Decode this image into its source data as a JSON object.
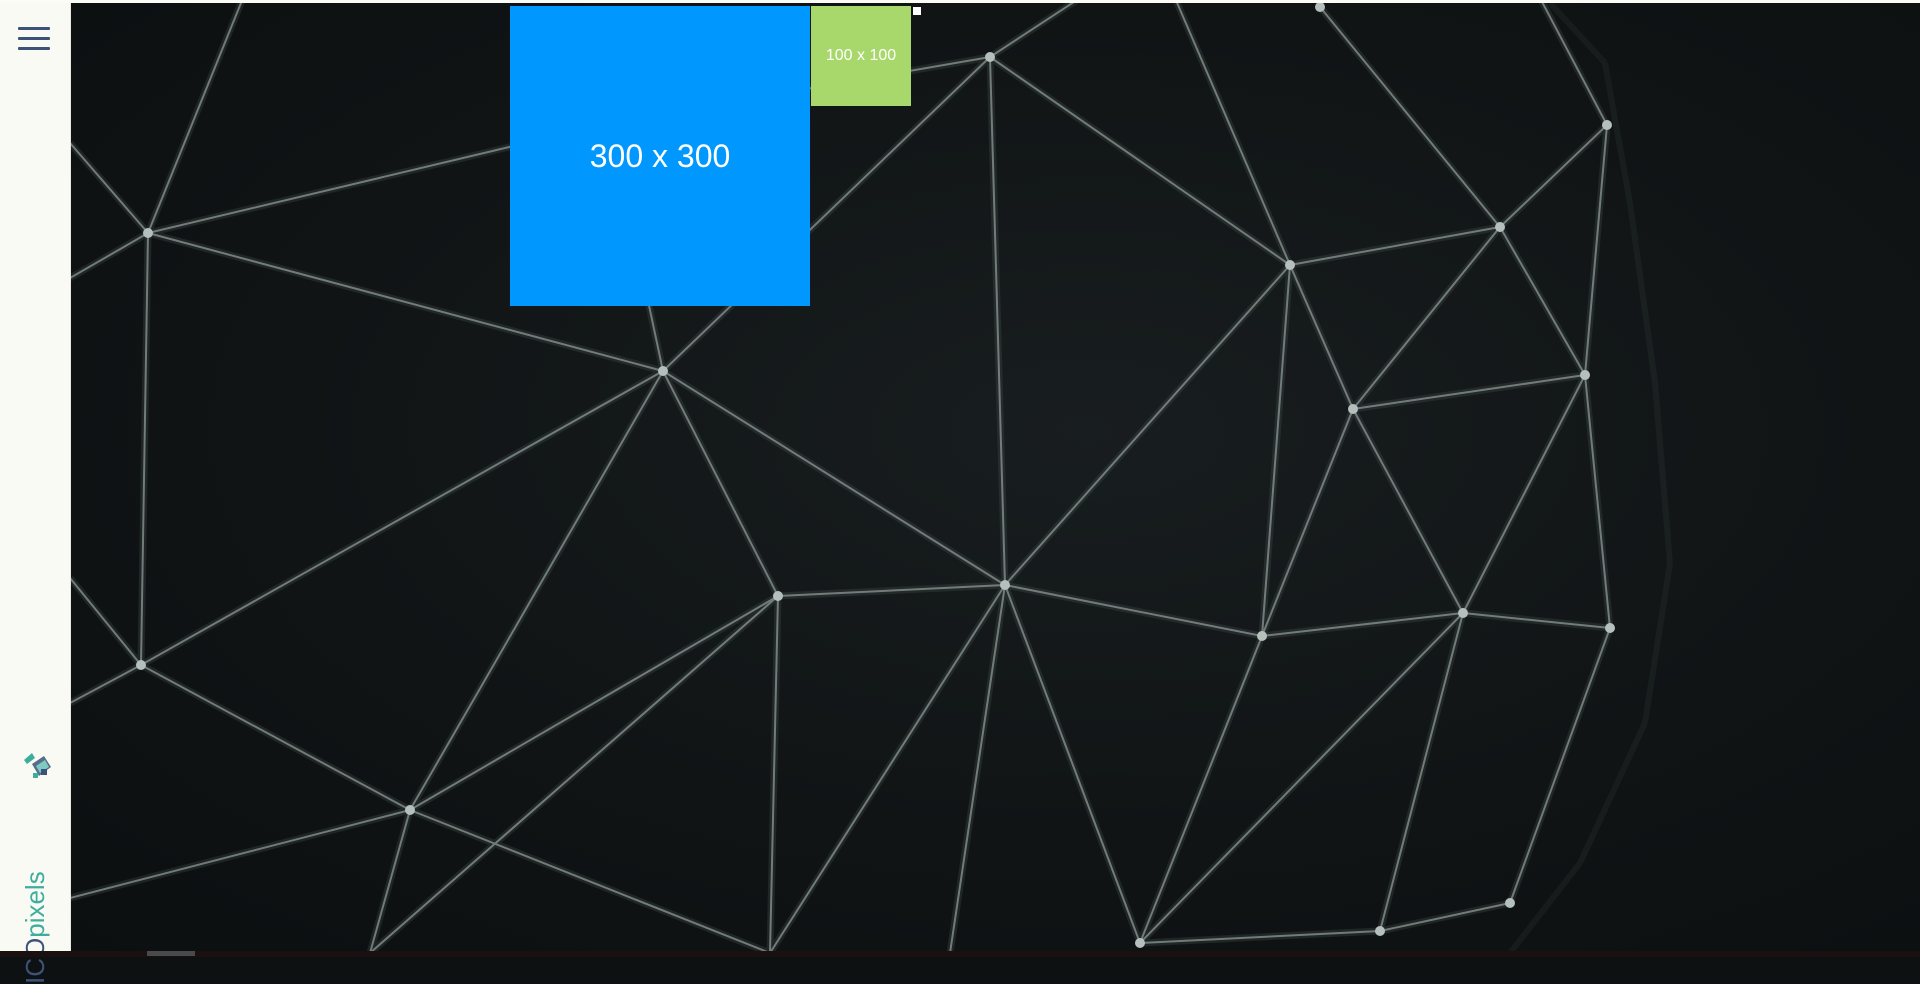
{
  "sidebar": {
    "menu_icon": "hamburger-menu-icon",
    "logo": {
      "text_primary": "ICO",
      "text_accent": "pixels",
      "mark_icon": "icopixels-logo-mark-icon",
      "color_primary": "#3c5378",
      "color_accent": "#3dae9e"
    }
  },
  "ads": {
    "large": {
      "label": "300 x 300",
      "color": "#0098ff"
    },
    "small": {
      "label": "100 x 100",
      "color": "#a8d86b"
    }
  },
  "background": {
    "description_icon": "polygon-mesh-sphere-background",
    "color": "#0e1112"
  }
}
